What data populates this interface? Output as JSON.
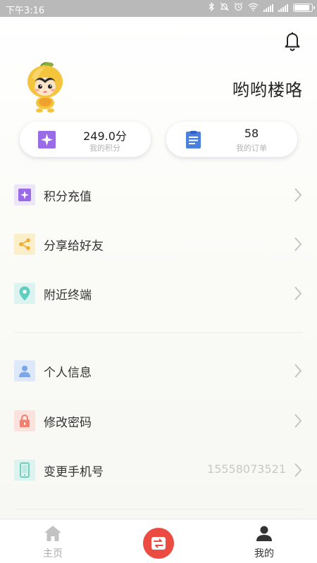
{
  "status_bar": {
    "time": "下午3:16",
    "battery_level": 0.9
  },
  "profile": {
    "username": "哟哟楼咯"
  },
  "stats": {
    "points": {
      "value": "249.0分",
      "label": "我的积分",
      "color": "#9a6be6"
    },
    "orders": {
      "value": "58",
      "label": "我的订单",
      "color": "#4a7fe0"
    }
  },
  "menu_group1": [
    {
      "label": "积分充值",
      "icon": "sparkle-icon",
      "color": "#9a6be6"
    },
    {
      "label": "分享给好友",
      "icon": "share-icon",
      "color": "#f0ad33"
    },
    {
      "label": "附近终端",
      "icon": "location-pin-icon",
      "color": "#5ecec0"
    }
  ],
  "menu_group2": [
    {
      "label": "个人信息",
      "icon": "person-icon",
      "color": "#7aa7ea"
    },
    {
      "label": "修改密码",
      "icon": "lock-icon",
      "color": "#ef8170"
    },
    {
      "label": "变更手机号",
      "icon": "phone-icon",
      "color": "#6ecec0",
      "value": "15558073521"
    }
  ],
  "tabbar": {
    "home": {
      "label": "主页",
      "icon": "home-icon"
    },
    "center": {
      "icon": "exchange-icon",
      "color": "#ec4b42"
    },
    "mine": {
      "label": "我的",
      "icon": "person-icon"
    }
  }
}
